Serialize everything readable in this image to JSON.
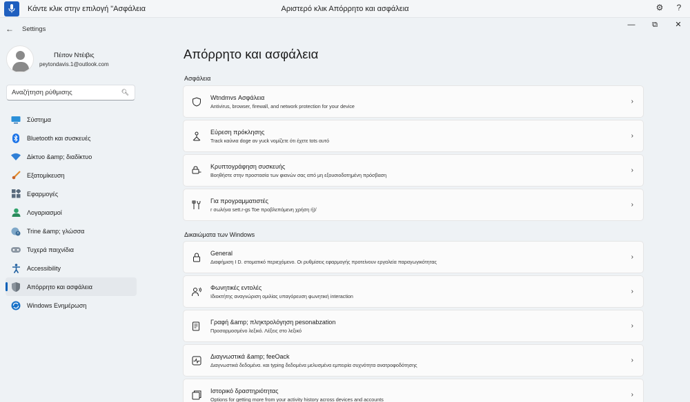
{
  "voice_bar": {
    "left_text": "Κάντε κλικ στην επιλογή \"Ασφάλεια",
    "center_text": "Αριστερό κλικ Απόρρητο και ασφάλεια"
  },
  "window": {
    "back_icon": "arrow-left-icon",
    "title": "Settings"
  },
  "profile": {
    "name": "Πέιτον Ντέιβις",
    "email": "peytondavis.1@outlook.com"
  },
  "search": {
    "placeholder": "Αναζήτηση ρύθμισης"
  },
  "nav": {
    "items": [
      {
        "label": "Σύστημα",
        "icon": "monitor-icon"
      },
      {
        "label": "Bluetooth και συσκευές",
        "icon": "bluetooth-icon"
      },
      {
        "label": "Δίκτυο &amp; διαδίκτυο",
        "icon": "wifi-icon"
      },
      {
        "label": "Εξατομίκευση",
        "icon": "brush-icon"
      },
      {
        "label": "Εφαρμογές",
        "icon": "apps-icon"
      },
      {
        "label": "Λογαριασμοί",
        "icon": "person-icon"
      },
      {
        "label": "Trine &amp; γλώσσα",
        "icon": "globe-clock-icon"
      },
      {
        "label": "Τυχερά παιχνίδια",
        "icon": "gamepad-icon"
      },
      {
        "label": "Accessibility",
        "icon": "accessibility-icon"
      },
      {
        "label": "Απόρρητο και ασφάλεια",
        "icon": "shield-icon"
      },
      {
        "label": "Windows Ενημέρωση",
        "icon": "update-icon"
      }
    ]
  },
  "main": {
    "title": "Απόρρητο και ασφάλεια",
    "section_security": "Ασφάλεια",
    "section_windows": "Δικαιώματα των Windows",
    "security_cards": [
      {
        "title": "Wtndmvs Ασφάλεια",
        "desc": "Antivirus, browser, firewall, and network protection for your device",
        "icon": "shield-outline-icon"
      },
      {
        "title": "Εύρεση πρόκλησης",
        "desc": "Track καύνια doge αν yuck νομίζετε ότι έχετε tots αυτό",
        "icon": "location-person-icon"
      },
      {
        "title": "Κρυπτογράφηση συσκευής",
        "desc": "Βοηθήστε στην προστασία των φιανών σας από μη εξουσιοδοτημένη πρόσβαση",
        "icon": "lock-key-icon"
      },
      {
        "title": "Για προγραμματιστές",
        "desc": "r σωλήνα sett.r-gs Toe προβλεπόμενη χρήση ή)/",
        "icon": "tools-icon"
      }
    ],
    "windows_cards": [
      {
        "title": "General",
        "desc": "Διαφήμιση I D. στοματικό περιεχόμενο. Οι ρυθμίσεις εφαρμογής προτείνουν εργαλεία παραγωγικότητας",
        "icon": "lock-icon"
      },
      {
        "title": "Φωνητικές εντολές",
        "desc": "Ιδιοκτήτης αναγνώριση ομιλίας υπαγόρευση φωνητική interaction",
        "icon": "voice-person-icon"
      },
      {
        "title": "Γραφή &amp; πληκτρολόγηση pesonabzation",
        "desc": "Προσαρμοσμένο λεξικό. Λέξεις στο λεξικό",
        "icon": "pen-document-icon"
      },
      {
        "title": "Διαγνωστικά &amp; feeOack",
        "desc": "Διαγνωστικά δεδομένα. και typing δεδομένα μελυσμένα εμπειρία συχνότητα ανατροφοδότησης",
        "icon": "diagnostics-icon"
      },
      {
        "title": "Ιστορικό δραστηριότητας",
        "desc": "Options for getting more from your activity history across devices and accounts",
        "icon": "activity-history-icon"
      }
    ]
  }
}
